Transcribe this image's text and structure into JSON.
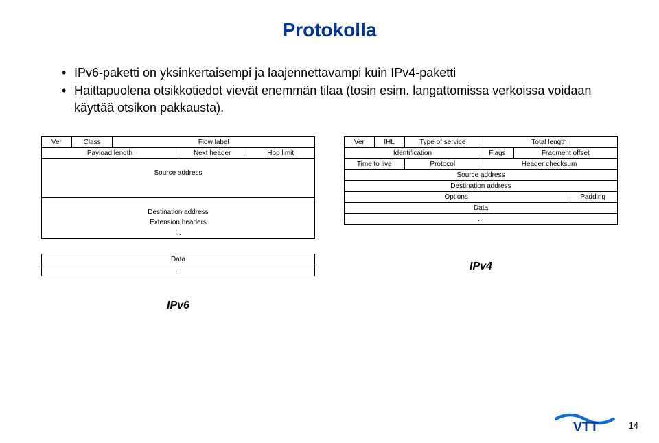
{
  "title": "Protokolla",
  "bullets": {
    "b1": "IPv6-paketti on yksinkertaisempi ja laajennettavampi kuin IPv4-paketti",
    "b2": "Haittapuolena otsikkotiedot vievät enemmän tilaa (tosin esim. langattomissa verkoissa voidaan käyttää otsikon pakkausta)."
  },
  "ipv6": {
    "ver": "Ver",
    "class": "Class",
    "flow_label": "Flow label",
    "payload_length": "Payload length",
    "next_header": "Next header",
    "hop_limit": "Hop limit",
    "source_address": "Source address",
    "destination_address": "Destination address",
    "extension_headers": "Extension headers",
    "dots1": "...",
    "data": "Data",
    "dots2": "...",
    "label": "IPv6"
  },
  "ipv4": {
    "ver": "Ver",
    "ihl": "IHL",
    "type_of_service": "Type of service",
    "total_length": "Total length",
    "identification": "Identification",
    "flags": "Flags",
    "fragment_offset": "Fragment offset",
    "time_to_live": "Time to live",
    "protocol": "Protocol",
    "header_checksum": "Header checksum",
    "source_address": "Source address",
    "destination_address": "Destination address",
    "options": "Options",
    "padding": "Padding",
    "data": "Data",
    "dots": "...",
    "label": "IPv4"
  },
  "page_number": "14"
}
